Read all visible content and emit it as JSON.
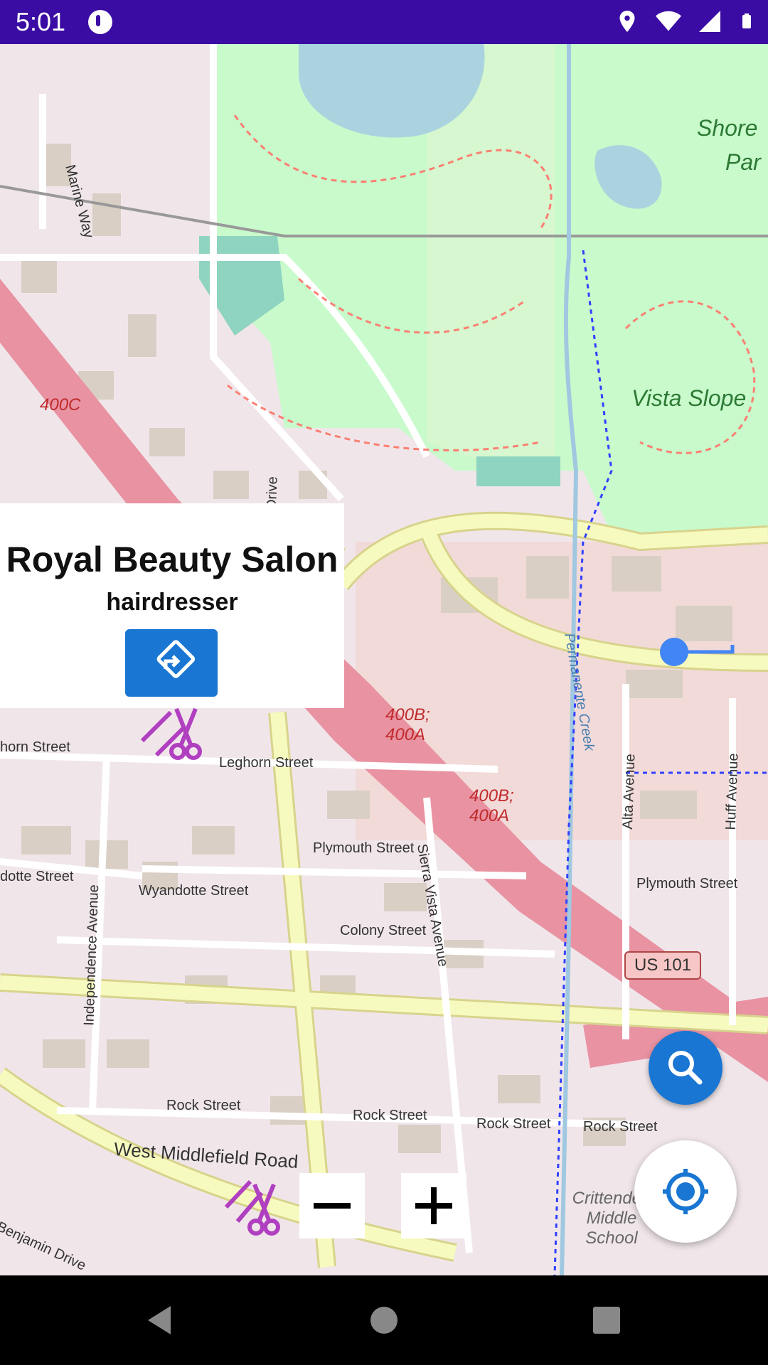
{
  "status_bar": {
    "time": "5:01",
    "icons": [
      "app-notification-icon",
      "location-icon",
      "wifi-icon",
      "signal-icon",
      "battery-icon"
    ]
  },
  "map": {
    "park_labels": [
      "Shore",
      "Par",
      "Vista Slope"
    ],
    "street_labels": [
      "Marine Way",
      "Plymouth Street",
      "Leghorn Street",
      "Wyandotte Street",
      "Colony Street",
      "Rock Street",
      "West Middlefield Road",
      "Independence Avenue",
      "Sierra Vista Avenue",
      "Alta Avenue",
      "Huff Avenue",
      "Permanente Creek",
      "Crittenden Middle School",
      "horn Street",
      "dotte Street",
      "Drive",
      "Benjamin Drive"
    ],
    "highway_labels": [
      "400C",
      "400B; 400A"
    ],
    "shield": "US 101"
  },
  "popup": {
    "title": "Royal Beauty Salon",
    "subtitle": "hairdresser",
    "directions_icon": "directions-icon"
  },
  "controls": {
    "zoom_out": "−",
    "zoom_in": "+",
    "search_icon": "search-icon",
    "locate_icon": "my-location-icon"
  },
  "colors": {
    "status_bar": "#3a0ca3",
    "accent": "#1976d2",
    "park": "#c8facc",
    "road_major": "#f7fabf",
    "highway": "#e892a2"
  }
}
